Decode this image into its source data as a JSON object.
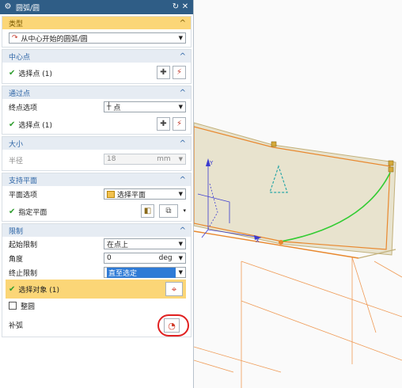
{
  "title": "圆弧/圆",
  "sections": {
    "type": {
      "header": "类型",
      "value": "从中心开始的圆弧/圆"
    },
    "center": {
      "header": "中心点",
      "select_label": "选择点 (1)"
    },
    "through": {
      "header": "通过点",
      "end_option_label": "终点选项",
      "end_option_value": "点",
      "select_label": "选择点 (1)"
    },
    "size": {
      "header": "大小",
      "radius_label": "半径",
      "radius_value": "18",
      "radius_unit": "mm"
    },
    "plane": {
      "header": "支持平面",
      "plane_option_label": "平面选项",
      "plane_option_value": "选择平面",
      "specify_label": "指定平面"
    },
    "limits": {
      "header": "限制",
      "start_label": "起始限制",
      "start_value": "在点上",
      "angle_label": "角度",
      "angle_value": "0",
      "angle_unit": "deg",
      "end_label": "终止限制",
      "end_value": "直至选定",
      "select_object_label": "选择对象 (1)",
      "full_circle_label": "整圆",
      "complement_label": "补弧"
    }
  },
  "colors": {
    "title_bar": "#2f5d86",
    "section_header": "#e6ecf3",
    "header_text": "#2c64a6",
    "highlight": "#fbd677",
    "check": "#2e9d2e",
    "arc": "#33cc33",
    "plane_edge": "#e8882e",
    "annotation_circle": "#e02020"
  }
}
